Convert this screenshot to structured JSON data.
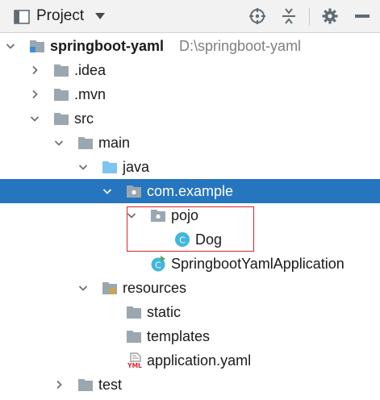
{
  "header": {
    "title": "Project",
    "icons": {
      "view": "project-view-icon",
      "dropdown": "chevron-down-icon",
      "locate": "locate-icon",
      "collapse": "collapse-all-icon",
      "settings": "gear-icon",
      "hide": "hide-icon"
    }
  },
  "tree": {
    "root": {
      "name": "springboot-yaml",
      "path": "D:\\springboot-yaml"
    },
    "idea": ".idea",
    "mvn": ".mvn",
    "src": "src",
    "main": "main",
    "java": "java",
    "com_example": "com.example",
    "pojo": "pojo",
    "dog": "Dog",
    "app": "SpringbootYamlApplication",
    "resources": "resources",
    "static": "static",
    "templates": "templates",
    "yaml": "application.yaml",
    "test": "test"
  },
  "colors": {
    "selection": "#2675bf",
    "folder": "#9aa7b0",
    "source_folder": "#7fc4f0",
    "class_icon": "#40b6e0",
    "highlight_border": "#d9232d"
  }
}
